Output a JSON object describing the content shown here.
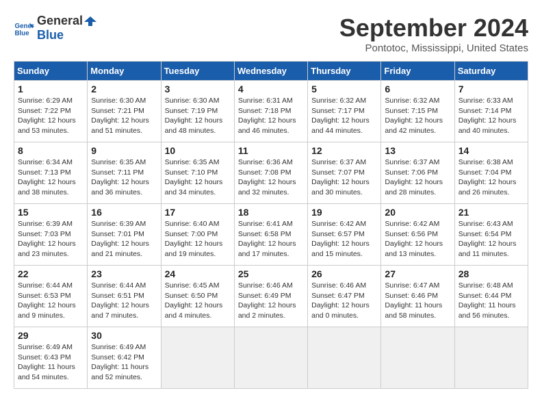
{
  "logo": {
    "text1": "General",
    "text2": "Blue"
  },
  "title": "September 2024",
  "location": "Pontotoc, Mississippi, United States",
  "headers": [
    "Sunday",
    "Monday",
    "Tuesday",
    "Wednesday",
    "Thursday",
    "Friday",
    "Saturday"
  ],
  "weeks": [
    [
      {
        "day": "1",
        "info": "Sunrise: 6:29 AM\nSunset: 7:22 PM\nDaylight: 12 hours\nand 53 minutes."
      },
      {
        "day": "2",
        "info": "Sunrise: 6:30 AM\nSunset: 7:21 PM\nDaylight: 12 hours\nand 51 minutes."
      },
      {
        "day": "3",
        "info": "Sunrise: 6:30 AM\nSunset: 7:19 PM\nDaylight: 12 hours\nand 48 minutes."
      },
      {
        "day": "4",
        "info": "Sunrise: 6:31 AM\nSunset: 7:18 PM\nDaylight: 12 hours\nand 46 minutes."
      },
      {
        "day": "5",
        "info": "Sunrise: 6:32 AM\nSunset: 7:17 PM\nDaylight: 12 hours\nand 44 minutes."
      },
      {
        "day": "6",
        "info": "Sunrise: 6:32 AM\nSunset: 7:15 PM\nDaylight: 12 hours\nand 42 minutes."
      },
      {
        "day": "7",
        "info": "Sunrise: 6:33 AM\nSunset: 7:14 PM\nDaylight: 12 hours\nand 40 minutes."
      }
    ],
    [
      {
        "day": "8",
        "info": "Sunrise: 6:34 AM\nSunset: 7:13 PM\nDaylight: 12 hours\nand 38 minutes."
      },
      {
        "day": "9",
        "info": "Sunrise: 6:35 AM\nSunset: 7:11 PM\nDaylight: 12 hours\nand 36 minutes."
      },
      {
        "day": "10",
        "info": "Sunrise: 6:35 AM\nSunset: 7:10 PM\nDaylight: 12 hours\nand 34 minutes."
      },
      {
        "day": "11",
        "info": "Sunrise: 6:36 AM\nSunset: 7:08 PM\nDaylight: 12 hours\nand 32 minutes."
      },
      {
        "day": "12",
        "info": "Sunrise: 6:37 AM\nSunset: 7:07 PM\nDaylight: 12 hours\nand 30 minutes."
      },
      {
        "day": "13",
        "info": "Sunrise: 6:37 AM\nSunset: 7:06 PM\nDaylight: 12 hours\nand 28 minutes."
      },
      {
        "day": "14",
        "info": "Sunrise: 6:38 AM\nSunset: 7:04 PM\nDaylight: 12 hours\nand 26 minutes."
      }
    ],
    [
      {
        "day": "15",
        "info": "Sunrise: 6:39 AM\nSunset: 7:03 PM\nDaylight: 12 hours\nand 23 minutes."
      },
      {
        "day": "16",
        "info": "Sunrise: 6:39 AM\nSunset: 7:01 PM\nDaylight: 12 hours\nand 21 minutes."
      },
      {
        "day": "17",
        "info": "Sunrise: 6:40 AM\nSunset: 7:00 PM\nDaylight: 12 hours\nand 19 minutes."
      },
      {
        "day": "18",
        "info": "Sunrise: 6:41 AM\nSunset: 6:58 PM\nDaylight: 12 hours\nand 17 minutes."
      },
      {
        "day": "19",
        "info": "Sunrise: 6:42 AM\nSunset: 6:57 PM\nDaylight: 12 hours\nand 15 minutes."
      },
      {
        "day": "20",
        "info": "Sunrise: 6:42 AM\nSunset: 6:56 PM\nDaylight: 12 hours\nand 13 minutes."
      },
      {
        "day": "21",
        "info": "Sunrise: 6:43 AM\nSunset: 6:54 PM\nDaylight: 12 hours\nand 11 minutes."
      }
    ],
    [
      {
        "day": "22",
        "info": "Sunrise: 6:44 AM\nSunset: 6:53 PM\nDaylight: 12 hours\nand 9 minutes."
      },
      {
        "day": "23",
        "info": "Sunrise: 6:44 AM\nSunset: 6:51 PM\nDaylight: 12 hours\nand 7 minutes."
      },
      {
        "day": "24",
        "info": "Sunrise: 6:45 AM\nSunset: 6:50 PM\nDaylight: 12 hours\nand 4 minutes."
      },
      {
        "day": "25",
        "info": "Sunrise: 6:46 AM\nSunset: 6:49 PM\nDaylight: 12 hours\nand 2 minutes."
      },
      {
        "day": "26",
        "info": "Sunrise: 6:46 AM\nSunset: 6:47 PM\nDaylight: 12 hours\nand 0 minutes."
      },
      {
        "day": "27",
        "info": "Sunrise: 6:47 AM\nSunset: 6:46 PM\nDaylight: 11 hours\nand 58 minutes."
      },
      {
        "day": "28",
        "info": "Sunrise: 6:48 AM\nSunset: 6:44 PM\nDaylight: 11 hours\nand 56 minutes."
      }
    ],
    [
      {
        "day": "29",
        "info": "Sunrise: 6:49 AM\nSunset: 6:43 PM\nDaylight: 11 hours\nand 54 minutes."
      },
      {
        "day": "30",
        "info": "Sunrise: 6:49 AM\nSunset: 6:42 PM\nDaylight: 11 hours\nand 52 minutes."
      },
      {
        "day": "",
        "info": ""
      },
      {
        "day": "",
        "info": ""
      },
      {
        "day": "",
        "info": ""
      },
      {
        "day": "",
        "info": ""
      },
      {
        "day": "",
        "info": ""
      }
    ]
  ]
}
